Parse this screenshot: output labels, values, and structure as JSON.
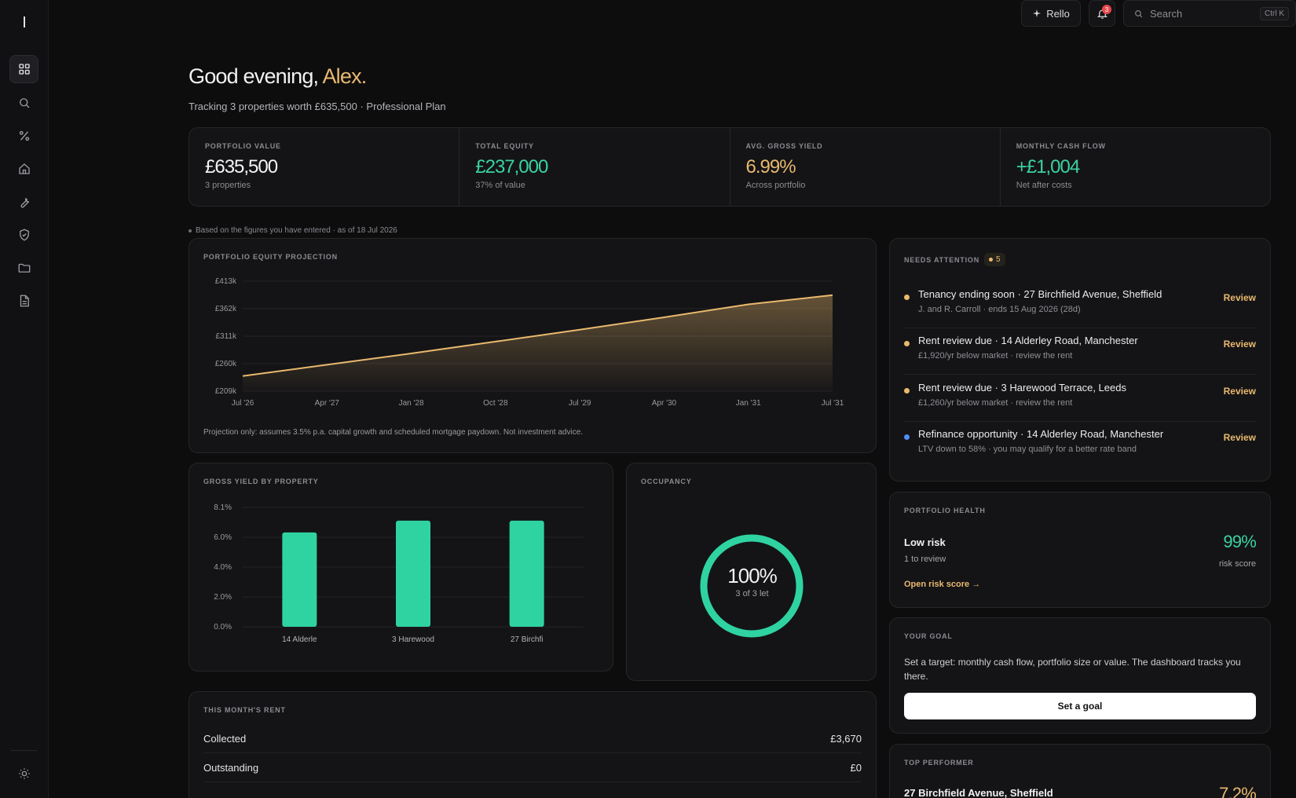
{
  "sidebar": {
    "logo": "I",
    "items": [
      {
        "name": "dashboard",
        "icon": "grid-icon",
        "active": true
      },
      {
        "name": "search",
        "icon": "search-icon"
      },
      {
        "name": "yield",
        "icon": "percent-icon"
      },
      {
        "name": "properties",
        "icon": "home-icon"
      },
      {
        "name": "maintenance",
        "icon": "wrench-icon"
      },
      {
        "name": "compliance",
        "icon": "shield-check-icon"
      },
      {
        "name": "documents",
        "icon": "folder-icon"
      },
      {
        "name": "reports",
        "icon": "file-text-icon"
      }
    ],
    "theme_icon": "sun-icon"
  },
  "topbar": {
    "assistant_label": "Rello",
    "notification_count": "3",
    "search_placeholder": "Search",
    "search_shortcut": "Ctrl K"
  },
  "greeting": {
    "text": "Good evening, ",
    "name": "Alex.",
    "subtitle": "Tracking 3 properties worth £635,500 · Professional Plan"
  },
  "kpis": [
    {
      "label": "PORTFOLIO VALUE",
      "value": "£635,500",
      "note": "3 properties"
    },
    {
      "label": "TOTAL EQUITY",
      "value": "£237,000",
      "note": "37% of value"
    },
    {
      "label": "AVG. GROSS YIELD",
      "value": "6.99%",
      "note": "Across portfolio"
    },
    {
      "label": "MONTHLY CASH FLOW",
      "value": "+£1,004",
      "note": "Net after costs"
    }
  ],
  "figures_note": "Based on the figures you have entered · as of 18 Jul 2026",
  "projection": {
    "title": "PORTFOLIO EQUITY PROJECTION",
    "disclaimer": "Projection only: assumes 3.5% p.a. capital growth and scheduled mortgage paydown. Not investment advice."
  },
  "yield_chart": {
    "title": "GROSS YIELD BY PROPERTY"
  },
  "occupancy": {
    "title": "OCCUPANCY",
    "percent": "100%",
    "sub": "3 of 3 let",
    "fraction": 1.0
  },
  "rent": {
    "title": "THIS MONTH'S RENT",
    "rows": [
      {
        "label": "Collected",
        "value": "£3,670"
      },
      {
        "label": "Outstanding",
        "value": "£0"
      }
    ]
  },
  "attention": {
    "title": "NEEDS ATTENTION",
    "count": "5",
    "items": [
      {
        "title": "Tenancy ending soon · 27 Birchfield Avenue, Sheffield",
        "sub": "J. and R. Carroll · ends 15 Aug 2026 (28d)",
        "action": "Review",
        "color": "#e9b96e"
      },
      {
        "title": "Rent review due · 14 Alderley Road, Manchester",
        "sub": "£1,920/yr below market · review the rent",
        "action": "Review",
        "color": "#e9b96e"
      },
      {
        "title": "Rent review due · 3 Harewood Terrace, Leeds",
        "sub": "£1,260/yr below market · review the rent",
        "action": "Review",
        "color": "#e9b96e"
      },
      {
        "title": "Refinance opportunity · 14 Alderley Road, Manchester",
        "sub": "LTV down to 58% · you may qualify for a better rate band",
        "action": "Review",
        "color": "#4f8ff7"
      }
    ]
  },
  "health": {
    "title": "PORTFOLIO HEALTH",
    "label": "Low risk",
    "sub": "1 to review",
    "link": "Open risk score →",
    "score": "99%",
    "score_label": "risk score"
  },
  "goal": {
    "title": "YOUR GOAL",
    "text": "Set a target: monthly cash flow, portfolio size or value. The dashboard tracks you there.",
    "button": "Set a goal"
  },
  "top_performer": {
    "title": "TOP PERFORMER",
    "name": "27 Birchfield Avenue, Sheffield",
    "yield": "7.2%"
  },
  "chart_data": [
    {
      "type": "area",
      "title": "PORTFOLIO EQUITY PROJECTION",
      "x": [
        "Jul '26",
        "Apr '27",
        "Jan '28",
        "Oct '28",
        "Jul '29",
        "Apr '30",
        "Jan '31",
        "Jul '31"
      ],
      "series": [
        {
          "values": [
            237000,
            258000,
            279000,
            301000,
            323000,
            346000,
            370000,
            387000
          ]
        }
      ],
      "y_ticks": [
        "£413k",
        "£362k",
        "£311k",
        "£260k",
        "£209k"
      ],
      "ylim": [
        209000,
        413000
      ],
      "grid": true,
      "color": "#e9b96e"
    },
    {
      "type": "bar",
      "title": "GROSS YIELD BY PROPERTY",
      "categories": [
        "14 Alderle",
        "3 Harewood",
        "27 Birchfi"
      ],
      "values": [
        6.4,
        7.2,
        7.2
      ],
      "y_ticks": [
        "8.1%",
        "6.0%",
        "4.0%",
        "2.0%",
        "0.0%"
      ],
      "ylim": [
        0,
        8.1
      ],
      "grid": true,
      "color": "#2fd3a1"
    }
  ]
}
